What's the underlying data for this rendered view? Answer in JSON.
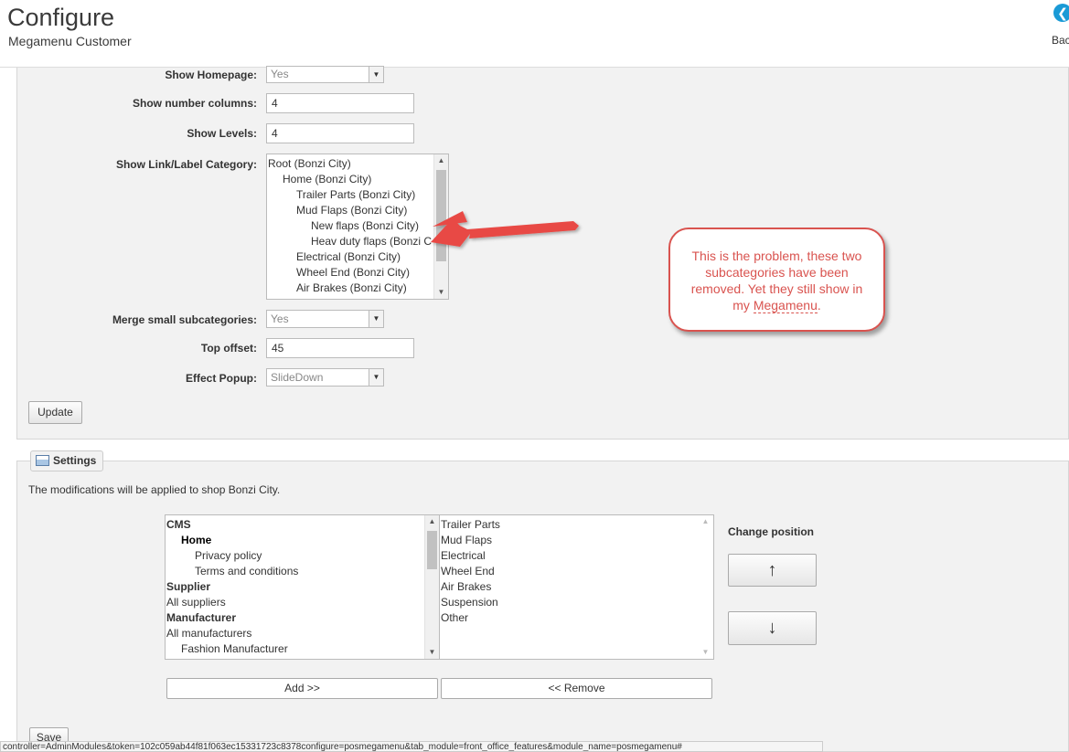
{
  "header": {
    "title": "Configure",
    "subtitle": "Megamenu Customer",
    "back_label": "Bac",
    "back_icon": "arrow-left-circle-icon",
    "back_color": "#1a9ad6"
  },
  "form": {
    "show_homepage": {
      "label": "Show Homepage:",
      "value": "Yes"
    },
    "show_number_columns": {
      "label": "Show number columns:",
      "value": "4"
    },
    "show_levels": {
      "label": "Show Levels:",
      "value": "4"
    },
    "show_link_label_category": {
      "label": "Show Link/Label Category:",
      "items": [
        "Root (Bonzi City)",
        "Home (Bonzi City)",
        "Trailer Parts (Bonzi City)",
        "Mud Flaps (Bonzi City)",
        "New flaps (Bonzi City)",
        "Heav duty flaps (Bonzi C",
        "Electrical (Bonzi City)",
        "Wheel End (Bonzi City)",
        "Air Brakes (Bonzi City)"
      ]
    },
    "merge_small_subcategories": {
      "label": "Merge small subcategories:",
      "value": "Yes"
    },
    "top_offset": {
      "label": "Top offset:",
      "value": "45"
    },
    "effect_popup": {
      "label": "Effect Popup:",
      "value": "SlideDown"
    },
    "update_label": "Update"
  },
  "callout": {
    "text_main": "This is the problem, these two subcategories have been removed. Yet they still show in my ",
    "text_word": "Megamenu",
    "text_end": ".",
    "color": "#d9534f"
  },
  "settings": {
    "legend": "Settings",
    "legend_icon": "settings-window-icon",
    "note": "The modifications will be applied to shop Bonzi City.",
    "available_items": [
      "CMS",
      "Home",
      "Privacy policy",
      "Terms and conditions",
      "Supplier",
      "All suppliers",
      "Manufacturer",
      "All manufacturers",
      "Fashion Manufacturer"
    ],
    "selected_items": [
      "Trailer Parts",
      "Mud Flaps",
      "Electrical",
      "Wheel End",
      "Air Brakes",
      "Suspension",
      "Other"
    ],
    "change_position_label": "Change position",
    "up_icon": "↑",
    "down_icon": "↓",
    "add_label": "Add >>",
    "remove_label": "<< Remove",
    "save_label": "Save"
  },
  "status_bar": {
    "url": "controller=AdminModules&token=102c059ab44f81f063ec15331723c8378configure=posmegamenu&tab_module=front_office_features&module_name=posmegamenu#"
  }
}
